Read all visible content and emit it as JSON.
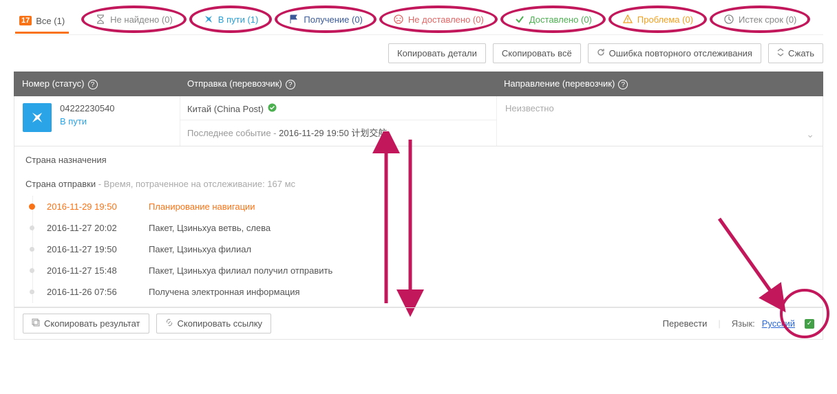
{
  "tabs": {
    "all": {
      "label": "Все (1)"
    },
    "notfound": {
      "label": "Не найдено (0)"
    },
    "transit": {
      "label": "В пути (1)"
    },
    "pickup": {
      "label": "Получение (0)"
    },
    "undeliv": {
      "label": "Не доставлено (0)"
    },
    "deliv": {
      "label": "Доставлено (0)"
    },
    "alert": {
      "label": "Проблема (0)"
    },
    "expired": {
      "label": "Истек срок (0)"
    }
  },
  "toolbar": {
    "copy_details": "Копировать детали",
    "copy_all": "Скопировать всё",
    "retrack_error": "Ошибка повторного отслеживания",
    "collapse": "Сжать"
  },
  "header": {
    "number_status": "Номер (статус)",
    "shipment_carrier": "Отправка (перевозчик)",
    "destination_carrier": "Направление (перевозчик)"
  },
  "result": {
    "tracking_no": "04222230540",
    "status": "В пути",
    "carrier": "Китай (China Post)",
    "last_event_label": "Последнее событие  -",
    "last_event_value": "2016-11-29 19:50 计划交航",
    "destination": "Неизвестно"
  },
  "details": {
    "dest_country_label": "Страна назначения",
    "origin_country_label": "Страна отправки",
    "time_spent": " - Время, потраченное на отслеживание: 167 мс",
    "events": [
      {
        "date": "2016-11-29 19:50",
        "text": "Планирование навигации"
      },
      {
        "date": "2016-11-27 20:02",
        "text": "Пакет, Цзиньхуа ветвь, слева"
      },
      {
        "date": "2016-11-27 19:50",
        "text": "Пакет, Цзиньхуа филиал"
      },
      {
        "date": "2016-11-27 15:48",
        "text": "Пакет, Цзиньхуа филиал получил отправить"
      },
      {
        "date": "2016-11-26 07:56",
        "text": "Получена электронная информация"
      }
    ]
  },
  "footer": {
    "copy_result": "Скопировать результат",
    "copy_link": "Скопировать ссылку",
    "translate": "Перевести",
    "language_label": "Язык:",
    "language_value": "Русский"
  }
}
